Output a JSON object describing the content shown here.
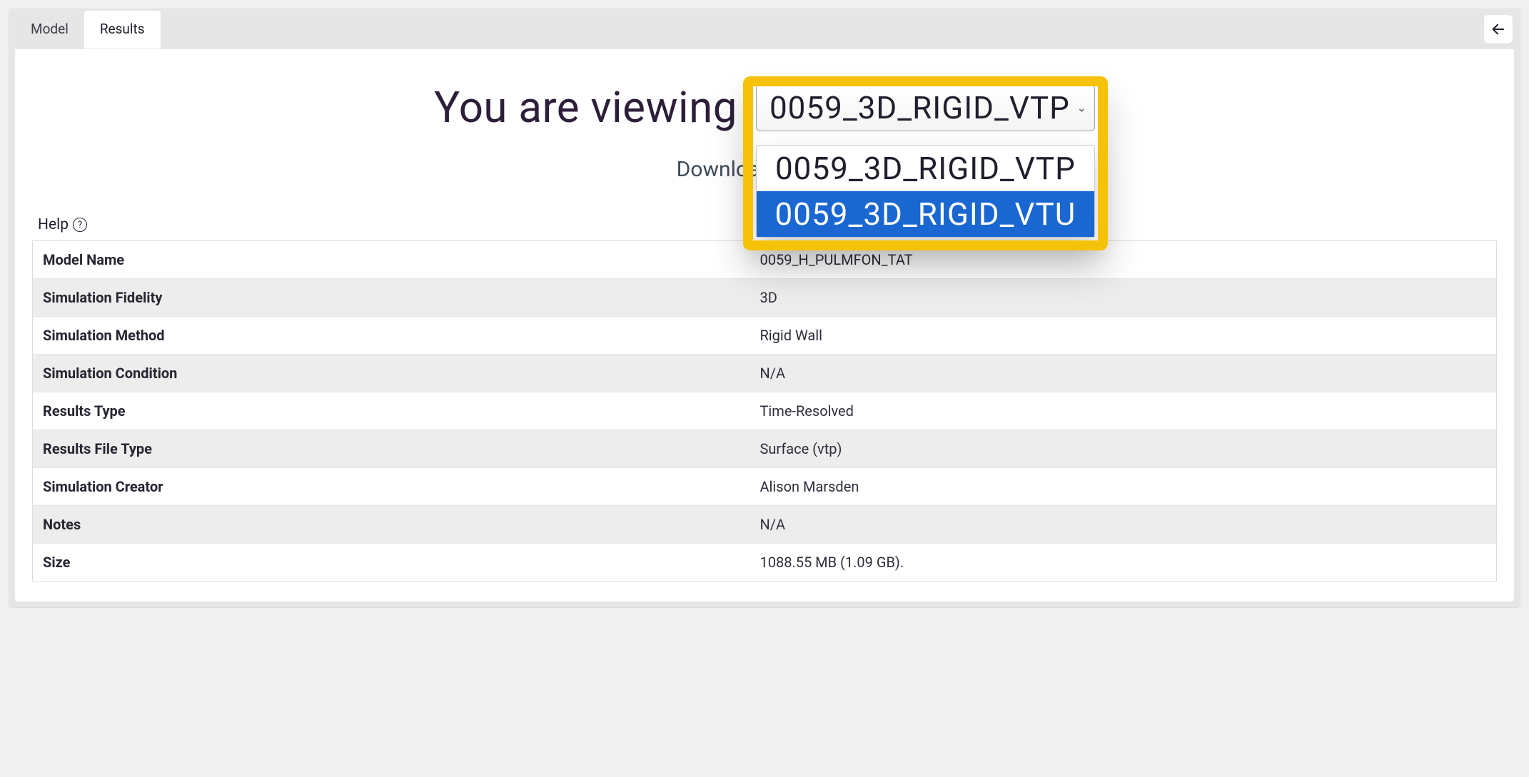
{
  "tabs": {
    "model": "Model",
    "results": "Results",
    "active": "results"
  },
  "headline_prefix": "You are viewing",
  "select": {
    "selected": "0059_3D_RIGID_VTP",
    "options": [
      "0059_3D_RIGID_VTP",
      "0059_3D_RIGID_VTU"
    ],
    "highlighted_index": 1
  },
  "subtext": "Download this sim",
  "help_label": "Help",
  "details": [
    {
      "key": "Model Name",
      "value": "0059_H_PULMFON_TAT"
    },
    {
      "key": "Simulation Fidelity",
      "value": "3D"
    },
    {
      "key": "Simulation Method",
      "value": "Rigid Wall"
    },
    {
      "key": "Simulation Condition",
      "value": "N/A"
    },
    {
      "key": "Results Type",
      "value": "Time-Resolved"
    },
    {
      "key": "Results File Type",
      "value": "Surface (vtp)"
    },
    {
      "key": "Simulation Creator",
      "value": "Alison Marsden"
    },
    {
      "key": "Notes",
      "value": "N/A"
    },
    {
      "key": "Size",
      "value": "1088.55 MB (1.09 GB)."
    }
  ]
}
